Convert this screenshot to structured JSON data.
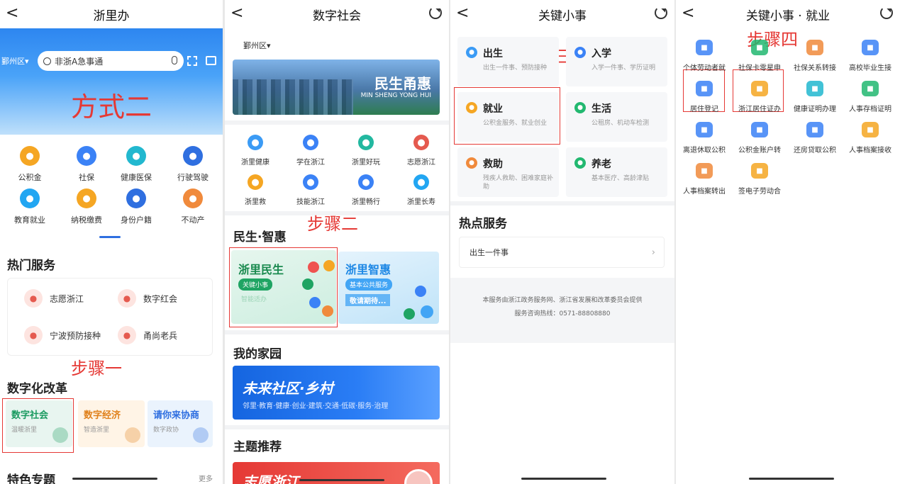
{
  "p1": {
    "title": "浙里办",
    "district": "鄞州区▾",
    "search_placeholder": "非浙A急事通",
    "banner_text": "方式二",
    "grid": [
      {
        "label": "公积金",
        "icon": "house-fund-icon",
        "color": "#f5a623"
      },
      {
        "label": "社保",
        "icon": "social-security-icon",
        "color": "#3b82f6"
      },
      {
        "label": "健康医保",
        "icon": "medical-icon",
        "color": "#22b8cf"
      },
      {
        "label": "行驶驾驶",
        "icon": "car-icon",
        "color": "#2f6fe0"
      },
      {
        "label": "教育就业",
        "icon": "graduation-icon",
        "color": "#22a6f2"
      },
      {
        "label": "纳税缴费",
        "icon": "tax-icon",
        "color": "#f5a623"
      },
      {
        "label": "身份户籍",
        "icon": "id-card-icon",
        "color": "#2f6fe0"
      },
      {
        "label": "不动产",
        "icon": "property-icon",
        "color": "#f08a3c"
      }
    ],
    "hot_title": "热门服务",
    "hot": [
      {
        "label": "志愿浙江",
        "icon": "volunteer-icon"
      },
      {
        "label": "数字红会",
        "icon": "red-cross-icon"
      },
      {
        "label": "宁波预防接种",
        "icon": "vaccine-icon"
      },
      {
        "label": "甬尚老兵",
        "icon": "veteran-icon"
      }
    ],
    "step1": "步骤一",
    "reform_title": "数字化改革",
    "reform": [
      {
        "t": "数字社会",
        "s": "温暖浙里"
      },
      {
        "t": "数字经济",
        "s": "智造浙里"
      },
      {
        "t": "请你来协商",
        "s": "数字政协"
      }
    ],
    "special_title": "特色专题",
    "more": "更多"
  },
  "p2": {
    "title": "数字社会",
    "district": "鄞州区▾",
    "banner_title": "民生甬惠",
    "banner_sub": "MIN SHENG  YONG HUI",
    "grid": [
      {
        "label": "浙里健康",
        "color": "#3b9bf5"
      },
      {
        "label": "学在浙江",
        "color": "#3b82f6"
      },
      {
        "label": "浙里好玩",
        "color": "#22b8a0"
      },
      {
        "label": "志愿浙江",
        "color": "#e55a4f"
      },
      {
        "label": "浙里救",
        "color": "#f5a623"
      },
      {
        "label": "技能浙江",
        "color": "#3b82f6"
      },
      {
        "label": "浙里畅行",
        "color": "#3b82f6"
      },
      {
        "label": "浙里长寿",
        "color": "#22a6f2"
      }
    ],
    "step2": "步骤二",
    "minsheng_title": "民生·智惠",
    "card1_title": "浙里民生",
    "card1_tag": "关键小事",
    "card1_sub": "智能适办",
    "card2_title": "浙里智惠",
    "card2_tag": "基本公共服务",
    "card2_sub": "敬请期待...",
    "home_title": "我的家园",
    "home_banner": "未来社区·乡村",
    "home_sub": "邻里·教育·健康·创业·建筑·交通·低碳·服务·治理",
    "theme_title": "主题推荐",
    "theme_banner": "志愿浙江"
  },
  "p3": {
    "title": "关键小事",
    "step3": "步骤三",
    "cats": [
      {
        "t": "出生",
        "s": "出生一件事、预防接种",
        "color": "#3b9bf5"
      },
      {
        "t": "入学",
        "s": "入学一件事、学历证明",
        "color": "#3b82f6"
      },
      {
        "t": "就业",
        "s": "公积金服务、就业创业",
        "color": "#f5a623"
      },
      {
        "t": "生活",
        "s": "公租房、机动车检测",
        "color": "#22b870"
      },
      {
        "t": "救助",
        "s": "残疾人救助、困难家庭补助",
        "color": "#f08a3c"
      },
      {
        "t": "养老",
        "s": "基本医疗、高龄津贴",
        "color": "#22b870"
      }
    ],
    "hot_title": "热点服务",
    "hot_item": "出生一件事",
    "footer1": "本服务由浙江政务服务网、浙江省发展和改革委员会提供",
    "footer2": "服务咨询热线：0571-88808880"
  },
  "p4": {
    "title": "关键小事 · 就业",
    "step4": "步骤四",
    "items": [
      {
        "label": "个体劳动者就",
        "color": "#3b82f6"
      },
      {
        "label": "社保卡零星申",
        "color": "#22b870"
      },
      {
        "label": "社保关系转接",
        "color": "#f08a3c"
      },
      {
        "label": "高校毕业生接",
        "color": "#3b82f6"
      },
      {
        "label": "居住登记",
        "color": "#3b82f6"
      },
      {
        "label": "浙江居住证办",
        "color": "#f5a623"
      },
      {
        "label": "健康证明办理",
        "color": "#22b8cf"
      },
      {
        "label": "人事存档证明",
        "color": "#22b870"
      },
      {
        "label": "离退休取公积",
        "color": "#3b82f6"
      },
      {
        "label": "公积金账户转",
        "color": "#3b82f6"
      },
      {
        "label": "还房贷取公积",
        "color": "#3b82f6"
      },
      {
        "label": "人事档案接收",
        "color": "#f5a623"
      },
      {
        "label": "人事档案转出",
        "color": "#f08a3c"
      },
      {
        "label": "签电子劳动合",
        "color": "#f5a623"
      }
    ]
  }
}
